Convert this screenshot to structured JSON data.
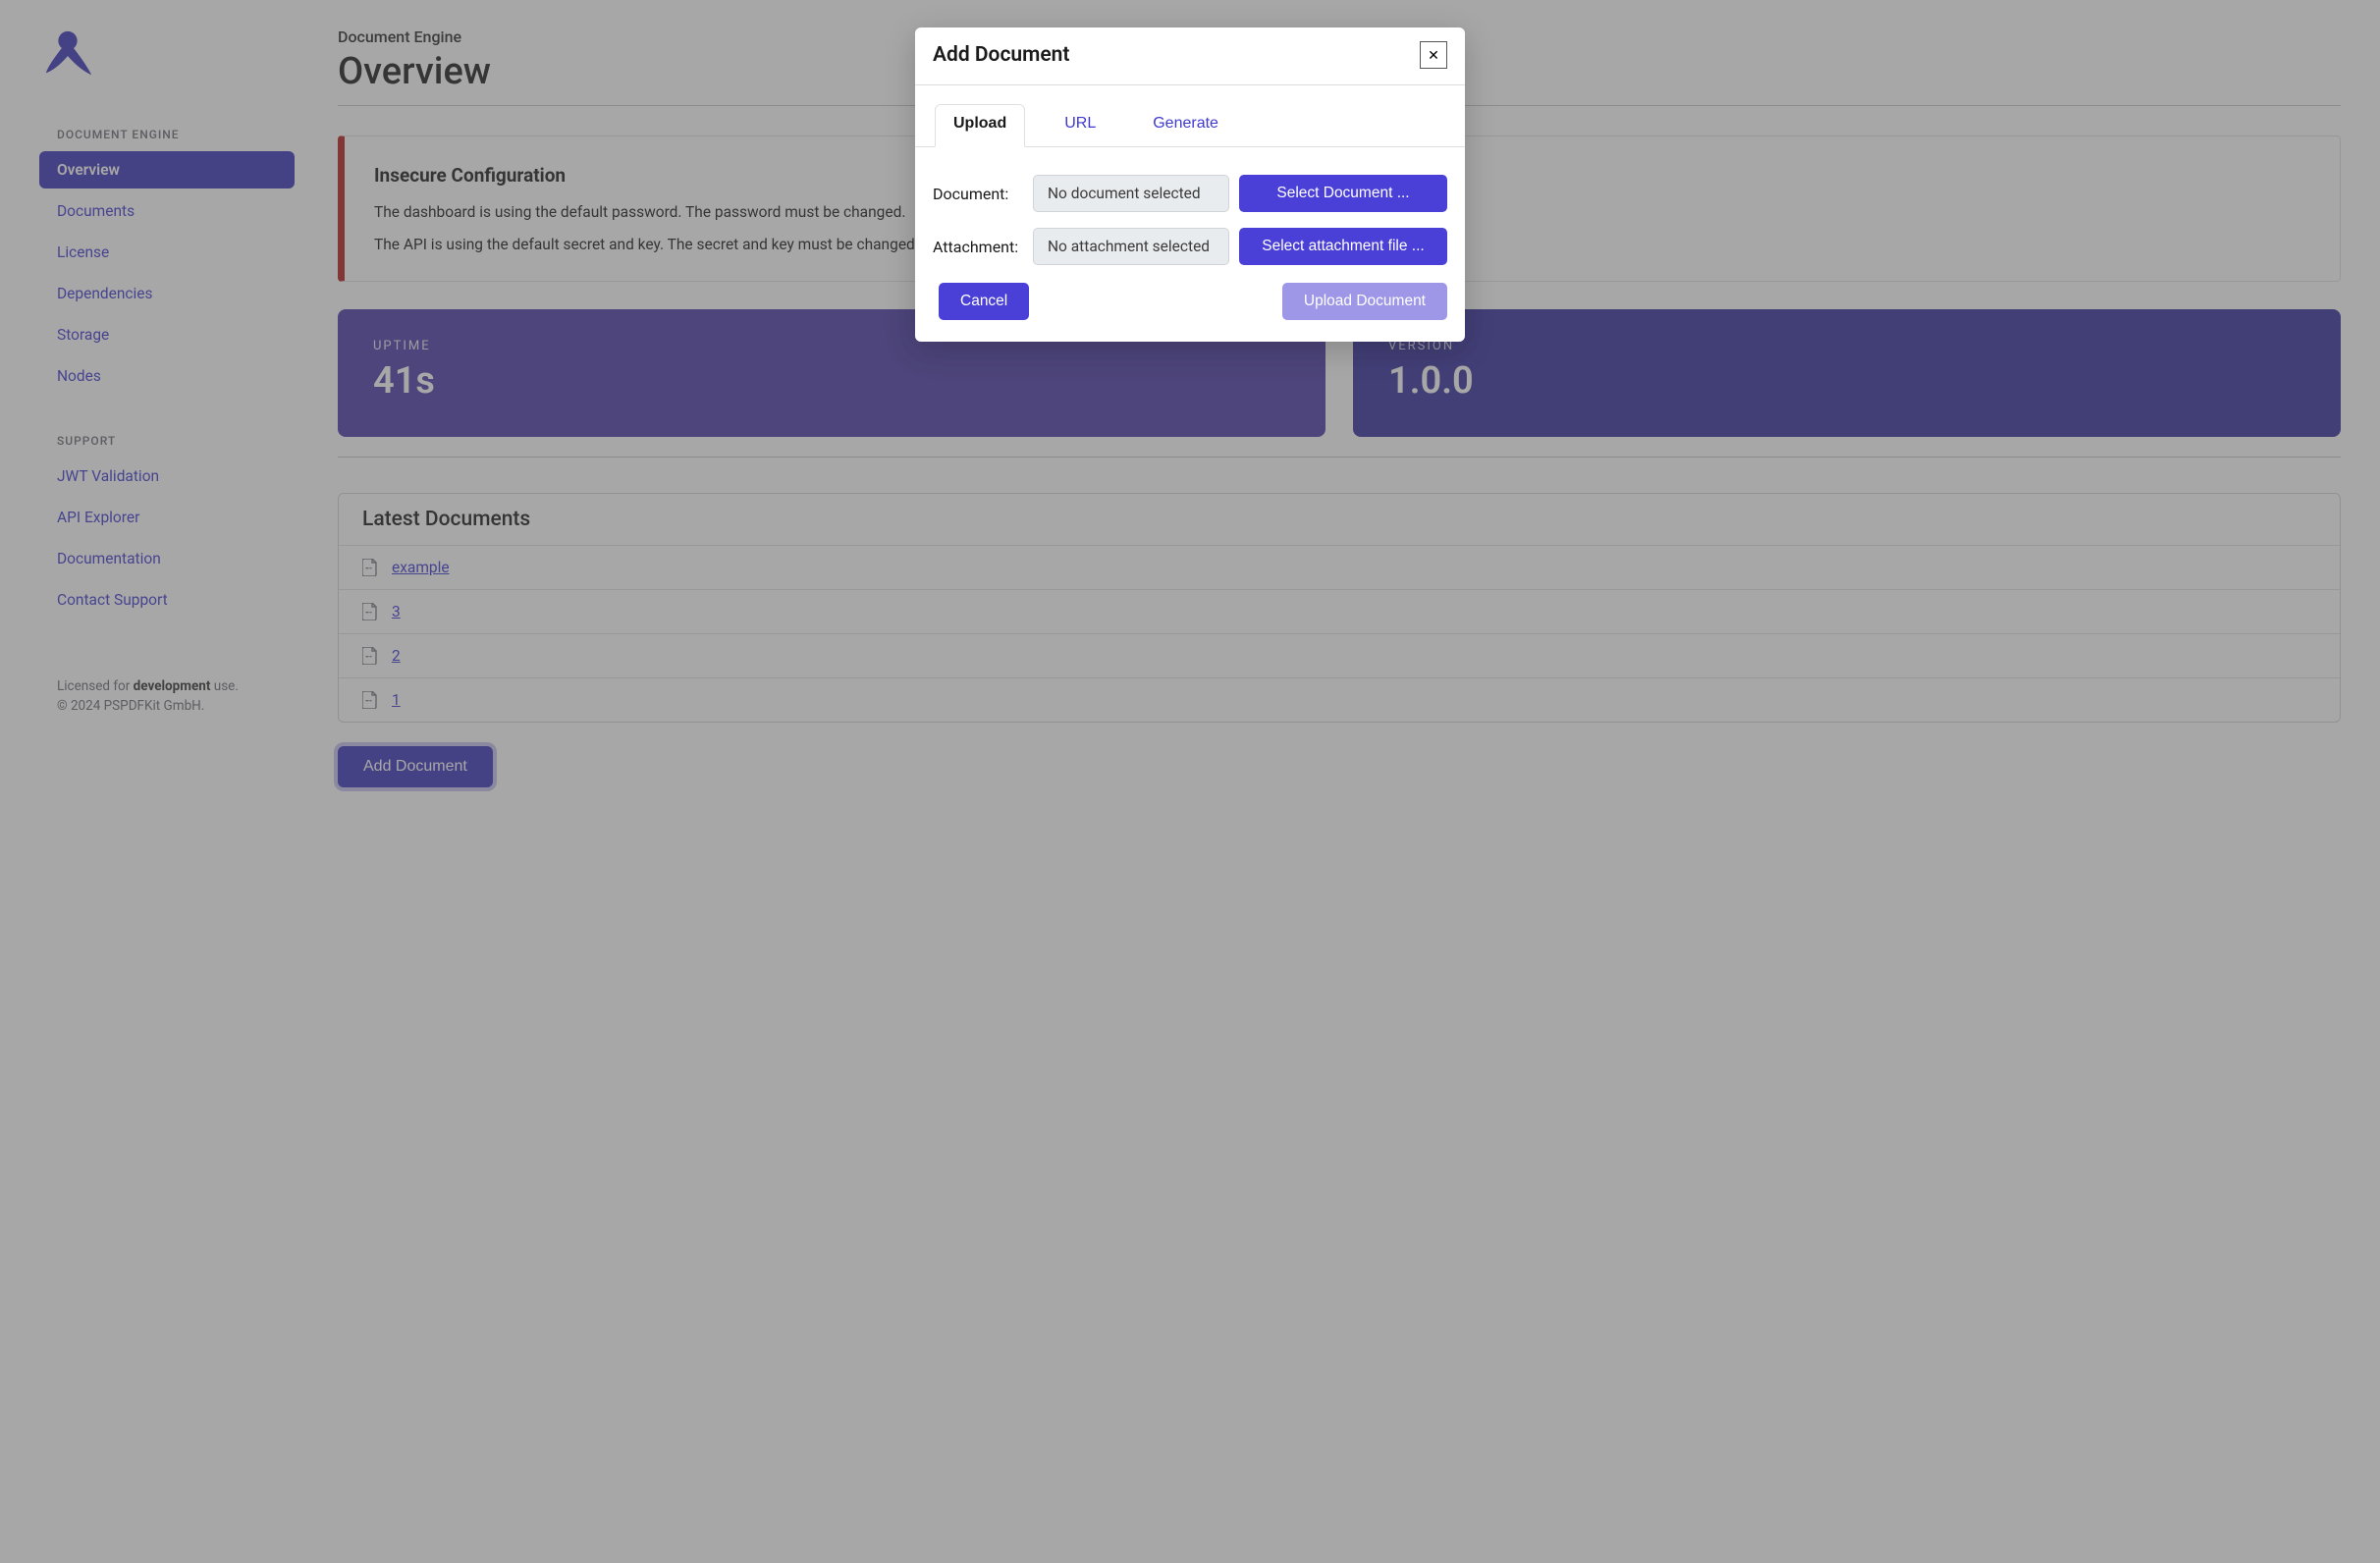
{
  "sidebar": {
    "section1_title": "DOCUMENT ENGINE",
    "items1": [
      {
        "label": "Overview",
        "active": true
      },
      {
        "label": "Documents",
        "active": false
      },
      {
        "label": "License",
        "active": false
      },
      {
        "label": "Dependencies",
        "active": false
      },
      {
        "label": "Storage",
        "active": false
      },
      {
        "label": "Nodes",
        "active": false
      }
    ],
    "section2_title": "SUPPORT",
    "items2": [
      {
        "label": "JWT Validation"
      },
      {
        "label": "API Explorer"
      },
      {
        "label": "Documentation"
      },
      {
        "label": "Contact Support"
      }
    ],
    "footer": {
      "line1_pre": "Licensed for ",
      "line1_strong": "development",
      "line1_post": " use.",
      "line2": "© 2024 PSPDFKit GmbH."
    }
  },
  "main": {
    "breadcrumb": "Document Engine",
    "title": "Overview",
    "alert": {
      "title": "Insecure Configuration",
      "lines": [
        "The dashboard is using the default password. The password must be changed.",
        "The API is using the default secret and key. The secret and key must be changed."
      ]
    },
    "stats": {
      "uptime_label": "UPTIME",
      "uptime_value": "41s",
      "version_label": "VERSION",
      "version_value": "1.0.0"
    },
    "documents": {
      "title": "Latest Documents",
      "items": [
        "example",
        "3",
        "2",
        "1"
      ]
    },
    "add_button": "Add Document"
  },
  "modal": {
    "title": "Add Document",
    "tabs": [
      "Upload",
      "URL",
      "Generate"
    ],
    "active_tab": 0,
    "rows": [
      {
        "label": "Document:",
        "value": "No document selected",
        "button": "Select Document ..."
      },
      {
        "label": "Attachment:",
        "value": "No attachment selected",
        "button": "Select attachment file ..."
      }
    ],
    "cancel": "Cancel",
    "upload": "Upload Document"
  }
}
